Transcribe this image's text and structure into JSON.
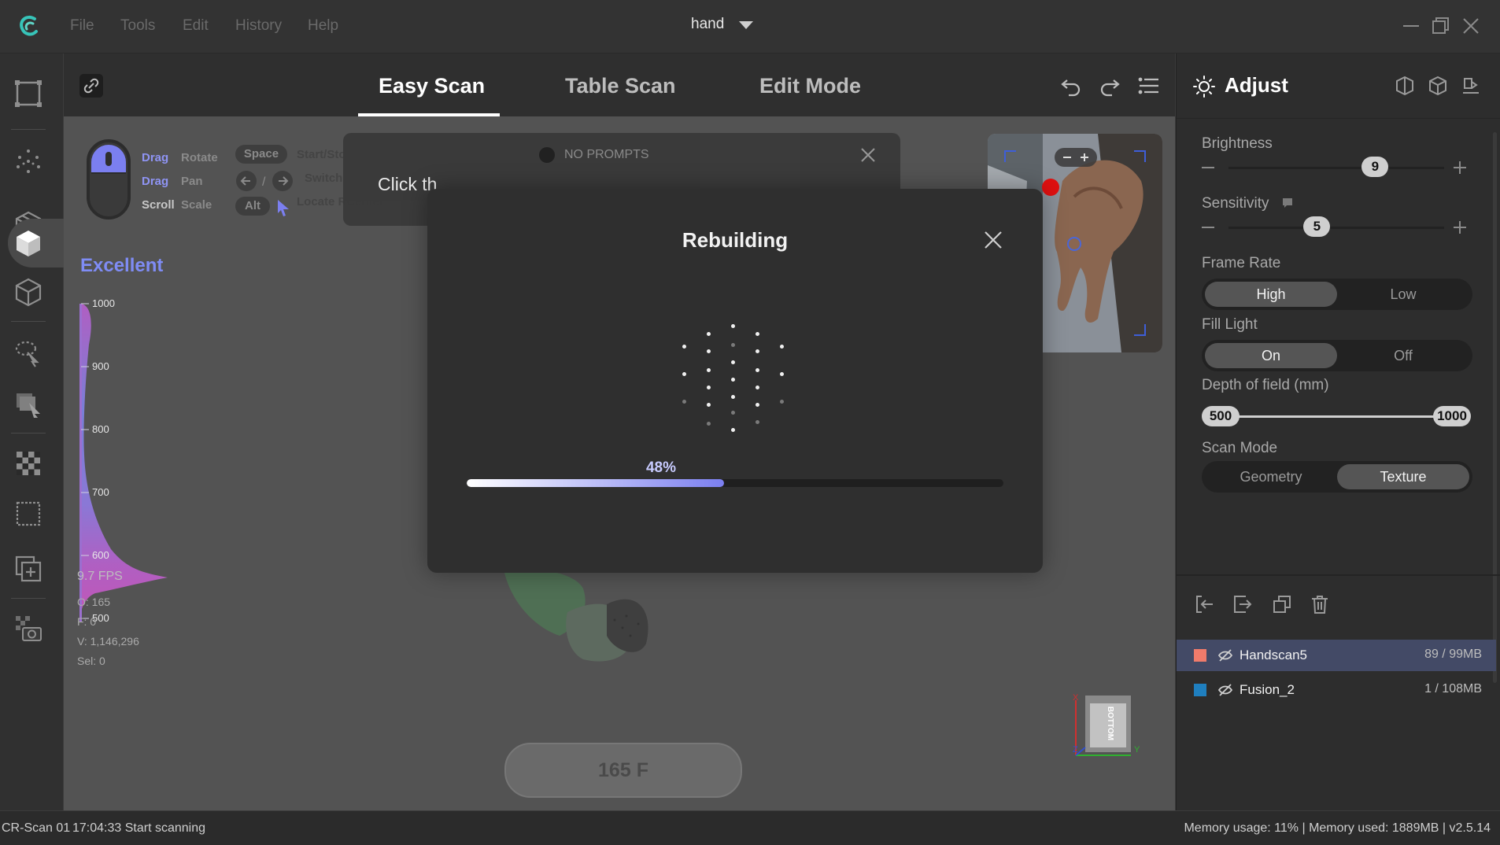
{
  "app": {
    "title": "hand",
    "menu": [
      "File",
      "Tools",
      "Edit",
      "History",
      "Help"
    ]
  },
  "tabs": [
    {
      "label": "Easy Scan",
      "active": true
    },
    {
      "label": "Table Scan",
      "active": false
    },
    {
      "label": "Edit Mode",
      "active": false
    }
  ],
  "left_toolbar": [
    "select-box-icon",
    "point-cloud-icon",
    "mesh-cube-icon",
    "solid-cube-icon",
    "cube-outline-icon",
    "lasso-select-icon",
    "rectangle-select-icon",
    "checker-texture-icon",
    "crop-rectangle-icon",
    "duplicate-add-icon",
    "camera-texture-icon"
  ],
  "hints": {
    "rows": [
      {
        "key": "Drag",
        "action": "Rotate"
      },
      {
        "key": "Drag",
        "action": "Pan"
      },
      {
        "key": "Scroll",
        "action": "Scale"
      }
    ],
    "space_key": "Space",
    "space_action": "Start/Stop Task",
    "arrows_action": "Switch Task",
    "alt_key": "Alt",
    "alt_action": "Locate RCenter"
  },
  "prompt": {
    "status": "NO PROMPTS",
    "text": "Click th"
  },
  "distance": {
    "quality": "Excellent",
    "ticks": [
      "1000",
      "900",
      "800",
      "700",
      "600",
      "500"
    ]
  },
  "stats": {
    "fps": "9.7 FPS",
    "o": "O: 165",
    "f": "F: 0",
    "v": "V: 1,146,296",
    "sel": "Sel: 0"
  },
  "frame_button": "165 F",
  "orientation_label": "BOTTOM",
  "modal": {
    "title": "Rebuilding",
    "progress_text": "48%",
    "progress": 0.48
  },
  "adjust": {
    "title": "Adjust",
    "brightness_label": "Brightness",
    "brightness_value": "9",
    "brightness_level": 0.68,
    "sensitivity_label": "Sensitivity",
    "sensitivity_value": "5",
    "sensitivity_level": 0.41,
    "frame_rate_label": "Frame Rate",
    "frame_rate_options": [
      "High",
      "Low"
    ],
    "frame_rate_selected": "High",
    "fill_light_label": "Fill Light",
    "fill_light_options": [
      "On",
      "Off"
    ],
    "fill_light_selected": "On",
    "dof_label": "Depth of field (mm)",
    "dof_min": "500",
    "dof_max": "1000",
    "scan_mode_label": "Scan Mode",
    "scan_mode_options": [
      "Geometry",
      "Texture"
    ],
    "scan_mode_selected": "Texture"
  },
  "layers": [
    {
      "name": "Handscan5",
      "info": "89 / 99MB",
      "color": "#f07b6b",
      "selected": true
    },
    {
      "name": "Fusion_2",
      "info": "1 / 108MB",
      "color": "#1f7fbf",
      "selected": false
    }
  ],
  "status": {
    "device": "CR-Scan 01",
    "message": "17:04:33 Start scanning",
    "memory": "Memory usage: 11% | Memory used: 1889MB | v2.5.14"
  },
  "colors": {
    "accent": "#7b7ff0",
    "quality": "#7f8cf5"
  }
}
